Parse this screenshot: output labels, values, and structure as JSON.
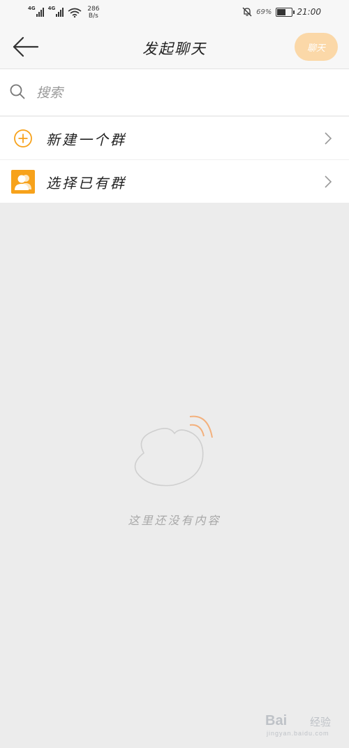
{
  "status_bar": {
    "network_1": "4G",
    "network_2": "4G",
    "speed_value": "286",
    "speed_unit": "B/s",
    "battery_percent": "69%",
    "battery_level": 0.69,
    "time": "21:00"
  },
  "header": {
    "title": "发起聊天",
    "chat_button_label": "聊天"
  },
  "search": {
    "placeholder": "搜索"
  },
  "list": {
    "items": [
      {
        "label": "新建一个群",
        "icon": "plus-circle-icon"
      },
      {
        "label": "选择已有群",
        "icon": "group-icon"
      }
    ]
  },
  "empty_state": {
    "message": "这里还没有内容"
  },
  "watermark": {
    "brand": "Bai",
    "tag": "经验",
    "site": "jingyan.baidu.com"
  },
  "colors": {
    "accent": "#f7a21b",
    "chat_button": "#fbd8a8",
    "background": "#ececec"
  }
}
